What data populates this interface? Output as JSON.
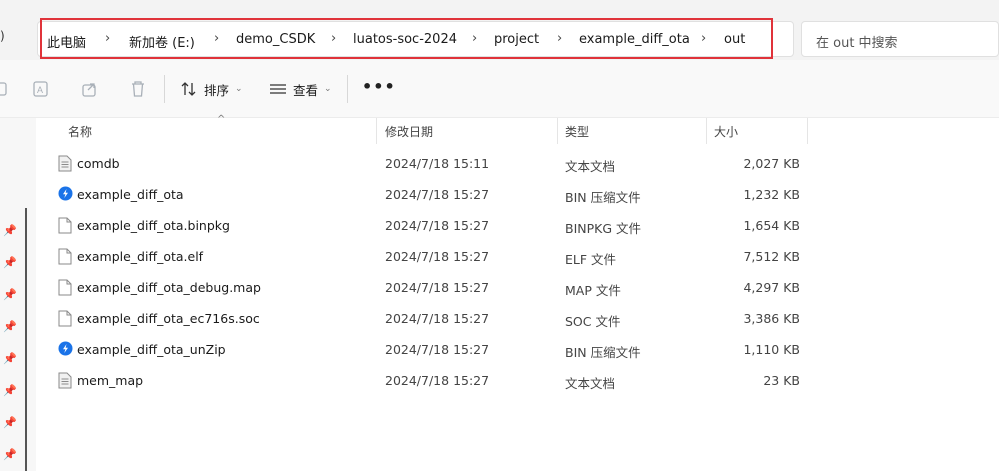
{
  "nav": {
    "fragment": ")"
  },
  "address": {
    "crumbs": [
      "此电脑",
      "新加卷 (E:)",
      "demo_CSDK",
      "luatos-soc-2024",
      "project",
      "example_diff_ota",
      "out"
    ],
    "separator": "›"
  },
  "search": {
    "placeholder": "在 out 中搜索"
  },
  "toolbar": {
    "sort_label": "排序",
    "view_label": "查看",
    "more_label": "•••",
    "caret": "⌄"
  },
  "columns": {
    "name": "名称",
    "modified": "修改日期",
    "type": "类型",
    "size": "大小"
  },
  "files": [
    {
      "name": "comdb",
      "date": "2024/7/18 15:11",
      "type": "文本文档",
      "size": "2,027 KB",
      "icon": "text-file-icon"
    },
    {
      "name": "example_diff_ota",
      "date": "2024/7/18 15:27",
      "type": "BIN 压缩文件",
      "size": "1,232 KB",
      "icon": "archive-app-icon"
    },
    {
      "name": "example_diff_ota.binpkg",
      "date": "2024/7/18 15:27",
      "type": "BINPKG 文件",
      "size": "1,654 KB",
      "icon": "blank-file-icon"
    },
    {
      "name": "example_diff_ota.elf",
      "date": "2024/7/18 15:27",
      "type": "ELF 文件",
      "size": "7,512 KB",
      "icon": "blank-file-icon"
    },
    {
      "name": "example_diff_ota_debug.map",
      "date": "2024/7/18 15:27",
      "type": "MAP 文件",
      "size": "4,297 KB",
      "icon": "blank-file-icon"
    },
    {
      "name": "example_diff_ota_ec716s.soc",
      "date": "2024/7/18 15:27",
      "type": "SOC 文件",
      "size": "3,386 KB",
      "icon": "blank-file-icon"
    },
    {
      "name": "example_diff_ota_unZip",
      "date": "2024/7/18 15:27",
      "type": "BIN 压缩文件",
      "size": "1,110 KB",
      "icon": "archive-app-icon"
    },
    {
      "name": "mem_map",
      "date": "2024/7/18 15:27",
      "type": "文本文档",
      "size": "23 KB",
      "icon": "text-file-icon"
    }
  ],
  "colors": {
    "highlight": "#e0333a",
    "accent": "#1a73e8"
  }
}
